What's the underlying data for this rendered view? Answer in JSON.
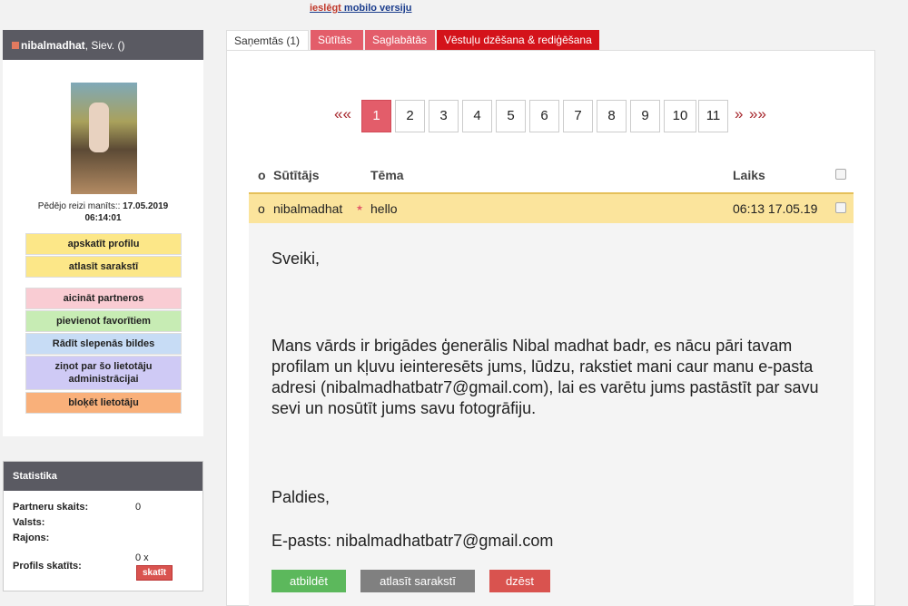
{
  "top": {
    "mobile_link_prefix": "ieslēgt",
    "mobile_link_rest": " mobilo versiju"
  },
  "profile": {
    "name": "nibalmadhat",
    "meta": ", Siev. ()",
    "lastseen_label": "Pēdējo reizi manīts:: ",
    "lastseen_date": "17.05.2019",
    "lastseen_time": "06:14:01",
    "buttons": [
      {
        "label": "apskatīt profilu",
        "color": "#fce788"
      },
      {
        "label": "atlasīt sarakstī",
        "color": "#fce788"
      },
      {
        "label": "aicināt partneros",
        "color": "#f9ccd3"
      },
      {
        "label": "pievienot favorītiem",
        "color": "#c7ecb4"
      },
      {
        "label": "Rādīt slepenās bildes",
        "color": "#c7dcf5"
      },
      {
        "label": "ziņot par šo lietotāju administrācijai",
        "color": "#cfcaf5"
      },
      {
        "label": "bloķēt lietotāju",
        "color": "#f9b07a"
      }
    ]
  },
  "stats": {
    "title": "Statistika",
    "partners_label": "Partneru skaits:",
    "partners_value": "0",
    "country_label": "Valsts:",
    "district_label": "Rajons:",
    "views_label": "Profils skatīts:",
    "views_value": "0 x",
    "views_button": "skatīt"
  },
  "tabs": [
    {
      "label": "Saņemtās (1)",
      "active": true
    },
    {
      "label": "Sūtītās",
      "active": false
    },
    {
      "label": "Saglabātās",
      "active": false
    },
    {
      "label": "Vēstuļu dzēšana & rediģēšana",
      "active": false
    }
  ],
  "pager": {
    "prev": "««",
    "pages": [
      "1",
      "2",
      "3",
      "4",
      "5",
      "6",
      "7",
      "8",
      "9",
      "10",
      "11"
    ],
    "active": 1,
    "next": "»",
    "last": "»»"
  },
  "table": {
    "col_marker": "o",
    "col_sender": "Sūtītājs",
    "col_subject": "Tēma",
    "col_time": "Laiks"
  },
  "message": {
    "marker": "o",
    "sender": "nibalmadhat",
    "star": "★",
    "subject": "hello",
    "time": "06:13 17.05.19",
    "greeting": "Sveiki,",
    "body": "Mans vārds ir brigādes ģenerālis Nibal madhat badr, es nācu pāri tavam profilam un kļuvu ieinteresēts jums, lūdzu, rakstiet mani caur manu e-pasta adresi (nibalmadhatbatr7@gmail.com), lai es varētu jums pastāstīt par savu sevi un nosūtīt jums savu fotogrāfiju.",
    "thanks": "Paldies,",
    "email_line": "E-pasts: nibalmadhatbatr7@gmail.com",
    "reply_button": "atbildēt",
    "list_button": "atlasīt sarakstī",
    "delete_button": "dzēst"
  }
}
